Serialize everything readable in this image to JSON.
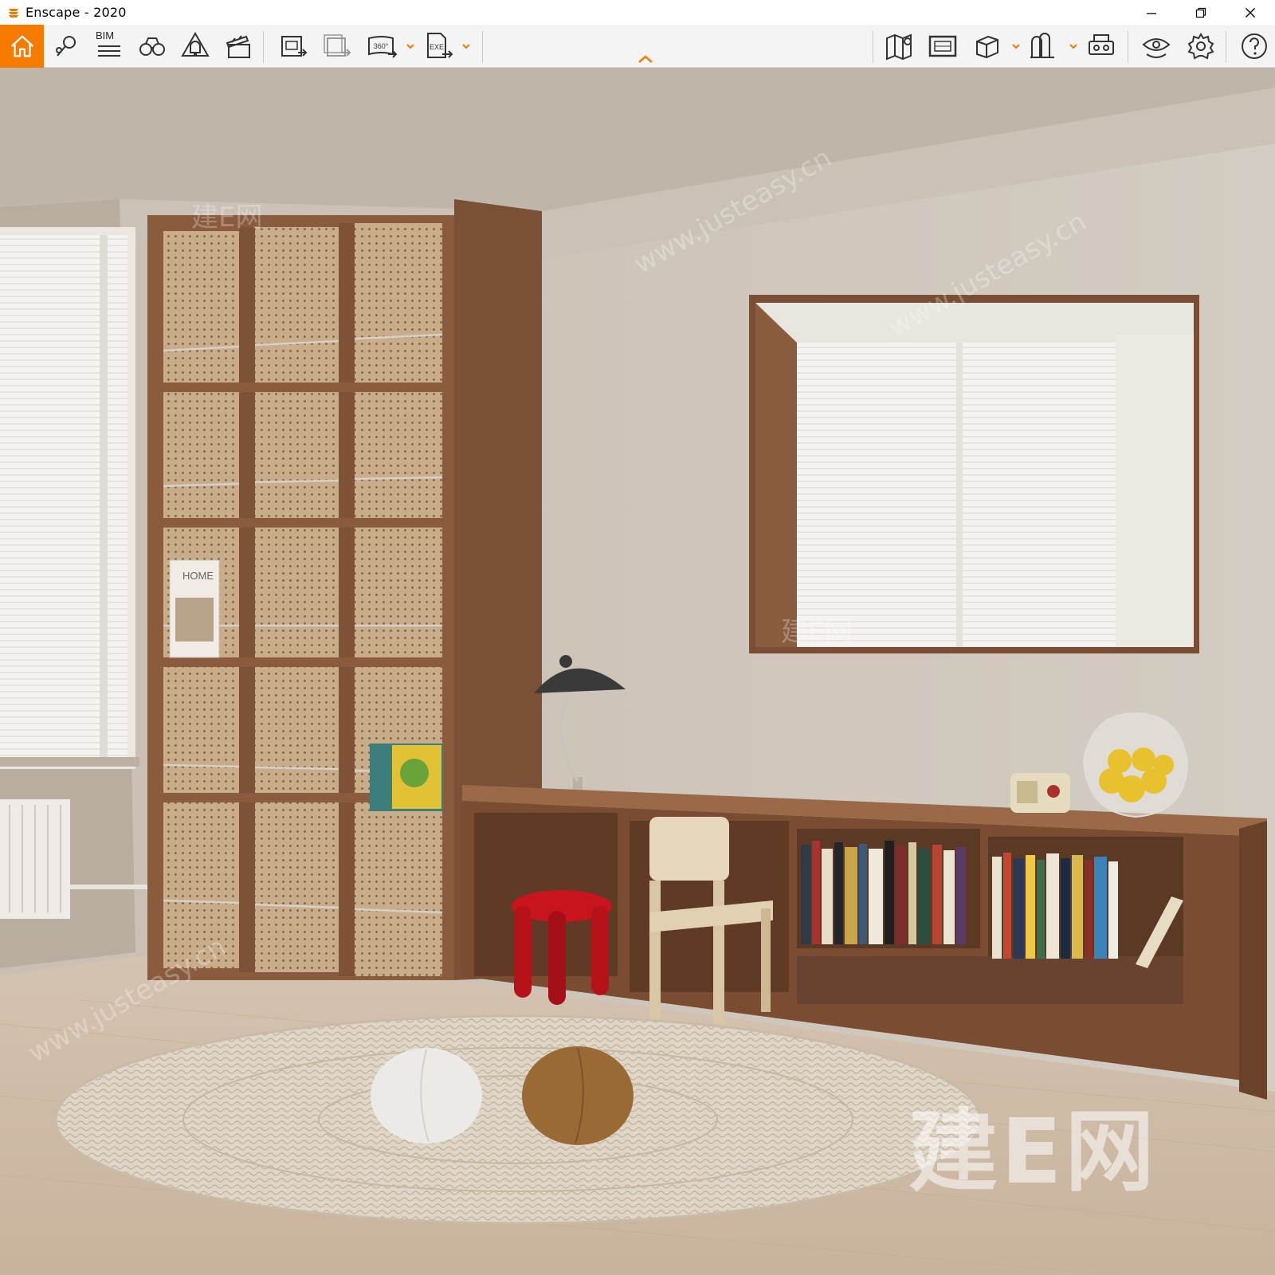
{
  "window": {
    "title": "Enscape - 2020",
    "controls": [
      "minimize",
      "restore",
      "close"
    ]
  },
  "toolbar": {
    "accent_color": "#f57b00",
    "left_icons": [
      "home-icon",
      "location-pin-icon",
      "bim-icon",
      "binoculars-icon",
      "bell-icon",
      "clapboard-icon",
      "screenshot-export-icon",
      "batch-export-icon",
      "panorama-360-icon",
      "exe-export-icon"
    ],
    "bim_label": "BIM",
    "panorama_label": "360°",
    "exe_label": "EXE",
    "right_icons": [
      "map-icon",
      "gallery-icon",
      "cube-icon",
      "asset-library-icon",
      "vr-headset-icon",
      "view-settings-icon",
      "settings-gear-icon",
      "help-icon"
    ]
  },
  "scene": {
    "description_kind": "3D render viewport",
    "poster_title": "HOME",
    "watermark_brand": "建E网",
    "watermark_url": "www.justeasy.cn"
  }
}
